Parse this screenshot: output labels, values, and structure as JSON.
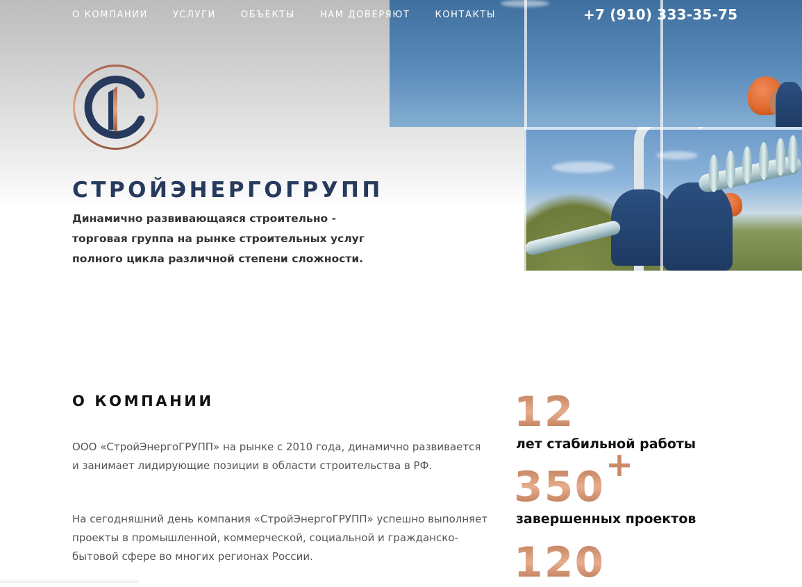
{
  "header": {
    "nav": [
      {
        "label": "О КОМПАНИИ"
      },
      {
        "label": "УСЛУГИ"
      },
      {
        "label": "ОБЪЕКТЫ"
      },
      {
        "label": "НАМ ДОВЕРЯЮТ"
      },
      {
        "label": "КОНТАКТЫ"
      }
    ],
    "phone": "+7 (910) 333-35-75"
  },
  "hero": {
    "logo_icon": "company-logo-c-monogram",
    "brand": "СТРОЙЭНЕРГОГРУПП",
    "tagline": "Динамично развивающаяся строительно - торговая группа на рынке строительных услуг полного цикла различной степени сложности.",
    "photo_icon": "power-line-workers-photo"
  },
  "about": {
    "title": "О КОМПАНИИ",
    "paragraphs": [
      "ООО «СтройЭнергоГРУПП» на рынке с 2010 года, динамично развивается и занимает лидирующие позиции в области строительства в РФ.",
      "На сегодняшний день компания «СтройЭнергоГРУПП» успешно выполняет проекты в промышленной, коммерческой, социальной и гражданско-бытовой сфере во многих регионах России."
    ]
  },
  "stats": [
    {
      "value": "12",
      "label": "лет стабильной работы"
    },
    {
      "value": "350",
      "suffix": "+",
      "label": "завершенных проектов"
    },
    {
      "value": "120",
      "label": ""
    }
  ],
  "colors": {
    "brand_navy": "#273a5d",
    "accent_copper": "#c98a65",
    "text_dark": "#111111",
    "text_muted": "#555555"
  }
}
